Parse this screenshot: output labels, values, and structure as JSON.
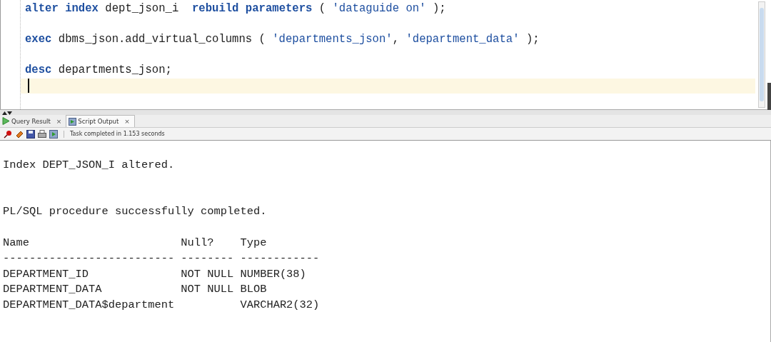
{
  "editor": {
    "lines": [
      {
        "tokens": [
          {
            "kind": "keyword",
            "text": "alter"
          },
          {
            "kind": "keyword",
            "text": "index"
          },
          {
            "kind": "plain",
            "text": "dept_json_i "
          },
          {
            "kind": "keyword",
            "text": "rebuild"
          },
          {
            "kind": "keyword",
            "text": "parameters"
          },
          {
            "kind": "plain",
            "text": "("
          },
          {
            "kind": "string",
            "text": "'dataguide on'"
          },
          {
            "kind": "plain",
            "text": ");"
          }
        ]
      },
      {
        "tokens": [
          {
            "kind": "keyword",
            "text": "exec"
          },
          {
            "kind": "plain",
            "text": "dbms_json.add_virtual_columns ("
          },
          {
            "kind": "string",
            "text": "'departments_json'"
          },
          {
            "kind": "plain",
            "text": ","
          },
          {
            "kind": "string",
            "text": "'department_data'"
          },
          {
            "kind": "plain",
            "text": ");"
          }
        ]
      },
      {
        "tokens": [
          {
            "kind": "keyword",
            "text": "desc"
          },
          {
            "kind": "plain",
            "text": "departments_json;"
          }
        ]
      }
    ],
    "current_line_highlight": true
  },
  "tabs": [
    {
      "label": "Query Result",
      "selected": false,
      "close": "×"
    },
    {
      "label": "Script Output",
      "selected": true,
      "close": "×"
    }
  ],
  "status": "Task completed in 1.153 seconds",
  "output": {
    "messages": [
      "Index DEPT_JSON_I altered.",
      "PL/SQL procedure successfully completed."
    ],
    "table": {
      "columns": [
        {
          "label": "Name",
          "rule": "--------------------------"
        },
        {
          "label": "Null?",
          "rule": "--------"
        },
        {
          "label": "Type",
          "rule": "------------"
        }
      ],
      "rows": [
        [
          "DEPARTMENT_ID",
          "NOT NULL",
          "NUMBER(38)"
        ],
        [
          "DEPARTMENT_DATA",
          "NOT NULL",
          "BLOB"
        ],
        [
          "DEPARTMENT_DATA$department",
          "",
          "VARCHAR2(32)"
        ]
      ]
    }
  }
}
